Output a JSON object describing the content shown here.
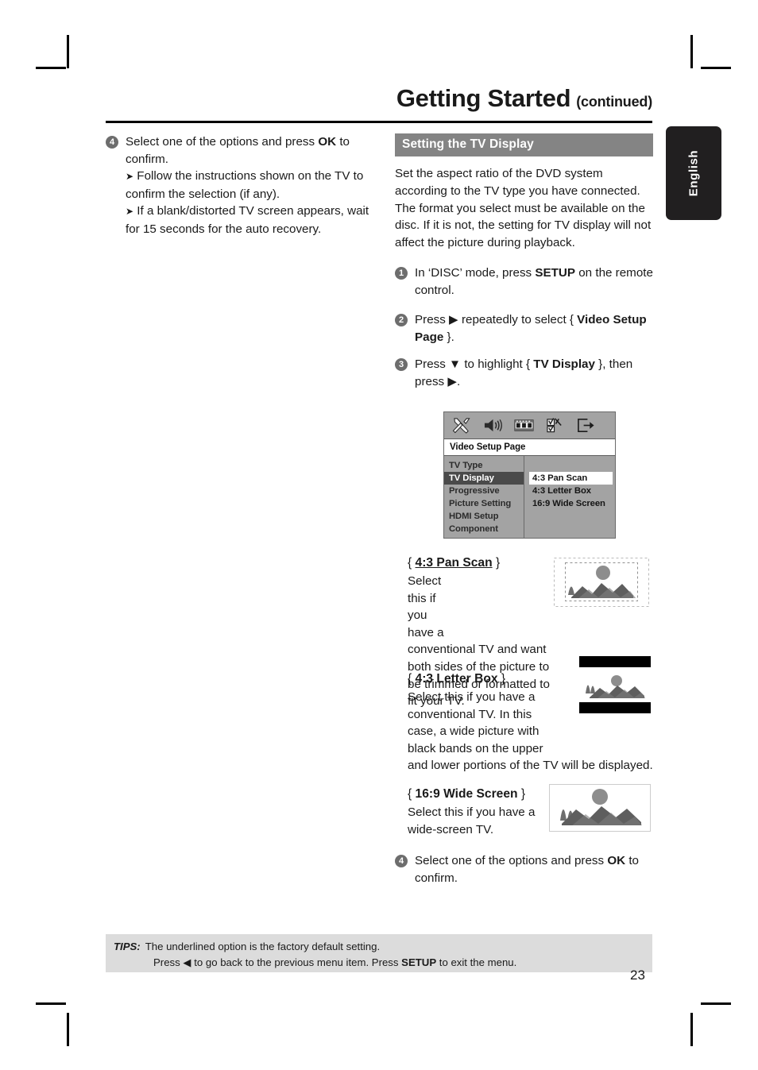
{
  "header": {
    "title": "Getting Started",
    "subtitle": "(continued)"
  },
  "language_tab": {
    "label": "English"
  },
  "left_column": {
    "step": {
      "number": "4",
      "text_before_bold": "Select one of the options and press ",
      "bold": "OK",
      "text_after_bold": " to confirm."
    },
    "notes": [
      "Follow the instructions shown on the TV to confirm the selection (if any).",
      "If a blank/distorted TV screen appears, wait for 15 seconds for the auto recovery."
    ]
  },
  "right_column": {
    "section_heading": "Setting the TV Display",
    "intro": "Set the aspect ratio of the DVD system according to the TV type you have connected. The format you select must be available on the disc.  If it is not, the setting for TV display will not affect the picture during playback.",
    "steps": [
      {
        "number": "1",
        "parts": [
          {
            "t": "In ‘DISC’ mode, press ",
            "b": false
          },
          {
            "t": "SETUP",
            "b": true
          },
          {
            "t": " on the remote control.",
            "b": false
          }
        ]
      },
      {
        "number": "2",
        "parts": [
          {
            "t": "Press ",
            "b": false
          },
          {
            "t": "▶",
            "b": false
          },
          {
            "t": " repeatedly to select { ",
            "b": false
          },
          {
            "t": "Video Setup Page",
            "b": true
          },
          {
            "t": " }.",
            "b": false
          }
        ]
      },
      {
        "number": "3",
        "parts": [
          {
            "t": "Press ",
            "b": false
          },
          {
            "t": "▼",
            "b": false
          },
          {
            "t": " to highlight { ",
            "b": false
          },
          {
            "t": "TV Display",
            "b": true
          },
          {
            "t": " }, then press ",
            "b": false
          },
          {
            "t": "▶",
            "b": false
          },
          {
            "t": ".",
            "b": false
          }
        ]
      }
    ],
    "final_step": {
      "number": "4",
      "text_before_bold": "Select one of the options and press ",
      "bold": "OK",
      "text_after_bold": " to confirm."
    }
  },
  "dvd_menu": {
    "icons": [
      "tools-icon",
      "speaker-icon",
      "film-icon",
      "preferences-icon",
      "exit-icon"
    ],
    "page_title": "Video Setup Page",
    "items": [
      {
        "label": "TV Type",
        "selected": false
      },
      {
        "label": "TV Display",
        "selected": true
      },
      {
        "label": "Progressive",
        "selected": false
      },
      {
        "label": "Picture Setting",
        "selected": false
      },
      {
        "label": "HDMI Setup",
        "selected": false
      },
      {
        "label": "Component",
        "selected": false
      }
    ],
    "options": [
      {
        "label": "4:3 Pan Scan",
        "highlighted": true
      },
      {
        "label": "4:3 Letter Box",
        "highlighted": false
      },
      {
        "label": "16:9 Wide Screen",
        "highlighted": false
      }
    ],
    "colors": {
      "background": "#a3a3a3",
      "selected_row": "#4a4a4a",
      "highlight_row": "#ffffff",
      "title_bar": "#ffffff"
    }
  },
  "option_descriptions": [
    {
      "open_brace": "{ ",
      "name": "4:3 Pan Scan",
      "close_brace": " }",
      "underlined": true,
      "body": "Select this if you have a conventional TV and want both sides of the picture to be trimmed or formatted to fit your TV.",
      "illustration": "pan-scan-illustration"
    },
    {
      "open_brace": "{ ",
      "name": "4:3 Letter Box",
      "close_brace": " }",
      "underlined": false,
      "body": "Select this if you have a conventional TV.  In this case, a wide picture with black bands on the upper and lower portions of the TV will be displayed.",
      "illustration": "letter-box-illustration"
    },
    {
      "open_brace": "{ ",
      "name": "16:9 Wide Screen",
      "close_brace": " }",
      "underlined": false,
      "body": "Select this if you have a wide-screen TV.",
      "illustration": "wide-screen-illustration"
    }
  ],
  "tips": {
    "label": "TIPS:",
    "line1": "The underlined option is the factory default setting.",
    "line2_parts": [
      {
        "t": "Press ",
        "b": false
      },
      {
        "t": "◀",
        "b": false
      },
      {
        "t": " to go back to the previous menu item.  Press ",
        "b": false
      },
      {
        "t": "SETUP",
        "b": true
      },
      {
        "t": " to exit the menu.",
        "b": false
      }
    ]
  },
  "page_number": "23",
  "colors": {
    "heading_bar": "#848484",
    "tips_background": "#dcdcdc",
    "step_bullet": "#6d6d6d",
    "tab_background": "#211f20"
  }
}
